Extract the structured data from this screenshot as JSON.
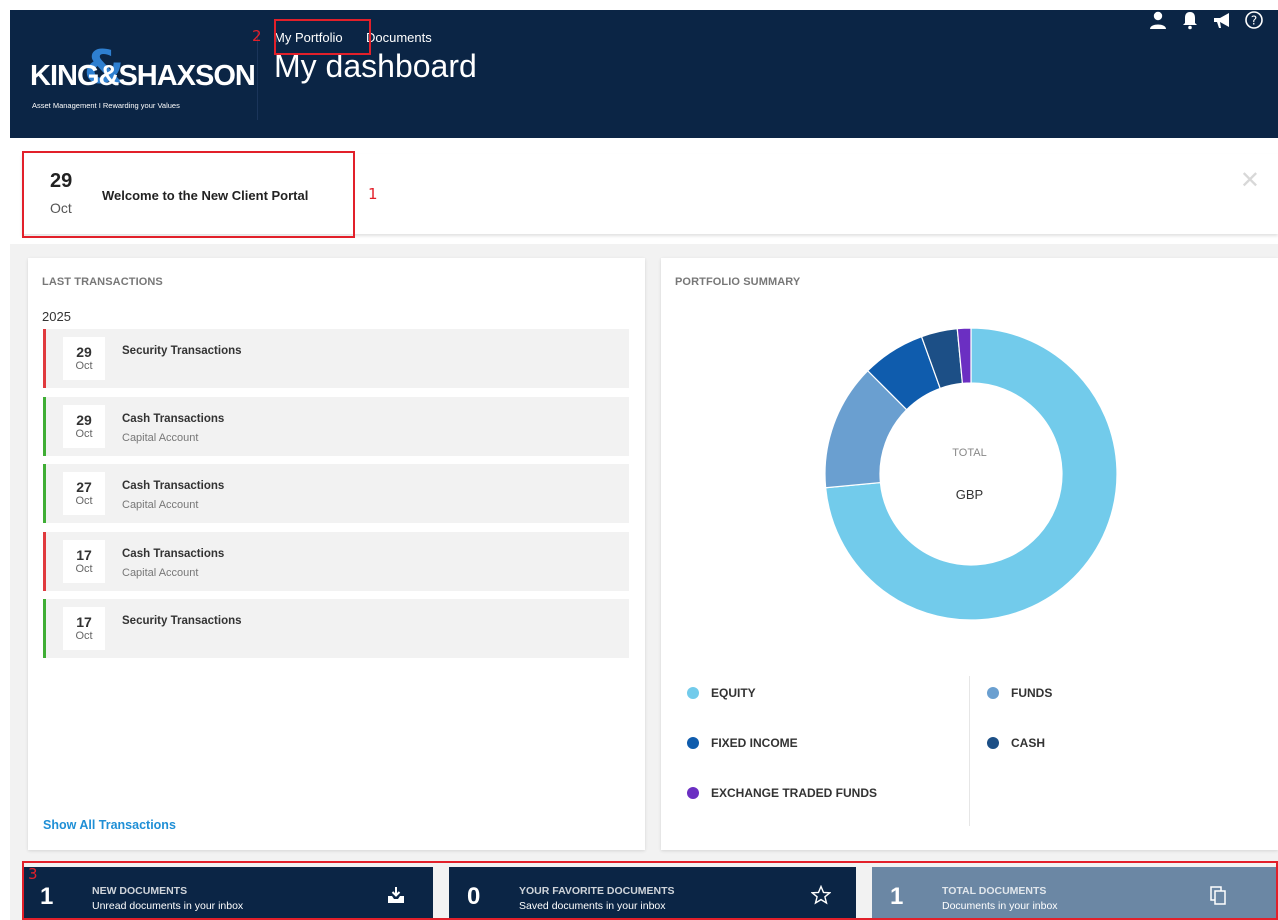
{
  "header": {
    "logo_text": "KING&SHAXSON",
    "logo_tagline": "Asset Management I Rewarding your Values",
    "nav": [
      "My Portfolio",
      "Documents"
    ],
    "title": "My dashboard",
    "icons": [
      "user-icon",
      "bell-icon",
      "megaphone-icon",
      "help-icon"
    ]
  },
  "announcement": {
    "day": "29",
    "month": "Oct",
    "text": "Welcome to the New Client Portal"
  },
  "annotations": [
    "1",
    "2",
    "3"
  ],
  "last_transactions": {
    "title": "LAST TRANSACTIONS",
    "year": "2025",
    "items": [
      {
        "day": "29",
        "month": "Oct",
        "title": "Security Transactions",
        "subtitle": "",
        "status_color": "#e03a3e"
      },
      {
        "day": "29",
        "month": "Oct",
        "title": "Cash Transactions",
        "subtitle": "Capital Account",
        "status_color": "#3fae35"
      },
      {
        "day": "27",
        "month": "Oct",
        "title": "Cash Transactions",
        "subtitle": "Capital Account",
        "status_color": "#3fae35"
      },
      {
        "day": "17",
        "month": "Oct",
        "title": "Cash Transactions",
        "subtitle": "Capital Account",
        "status_color": "#e03a3e"
      },
      {
        "day": "17",
        "month": "Oct",
        "title": "Security Transactions",
        "subtitle": "",
        "status_color": "#3fae35"
      }
    ],
    "show_all": "Show All Transactions"
  },
  "portfolio_summary": {
    "title": "PORTFOLIO SUMMARY",
    "center_label": "TOTAL",
    "currency": "GBP",
    "legend": [
      {
        "label": "EQUITY",
        "color": "#72cbeb"
      },
      {
        "label": "FUNDS",
        "color": "#6a9fd0"
      },
      {
        "label": "FIXED INCOME",
        "color": "#0f5cad"
      },
      {
        "label": "CASH",
        "color": "#1c4f86"
      },
      {
        "label": "EXCHANGE TRADED FUNDS",
        "color": "#6b2fc2"
      }
    ]
  },
  "chart_data": {
    "type": "pie",
    "title": "",
    "categories": [
      "EQUITY",
      "FUNDS",
      "FIXED INCOME",
      "CASH",
      "EXCHANGE TRADED FUNDS"
    ],
    "values": [
      73.5,
      14,
      7,
      4,
      1.5
    ],
    "colors": [
      "#72cbeb",
      "#6a9fd0",
      "#0f5cad",
      "#1c4f86",
      "#6b2fc2"
    ],
    "donut": true,
    "legend_position": "bottom"
  },
  "tiles": [
    {
      "count": "1",
      "title": "NEW DOCUMENTS",
      "subtitle": "Unread documents in your inbox",
      "icon": "inbox-download-icon"
    },
    {
      "count": "0",
      "title": "YOUR FAVORITE DOCUMENTS",
      "subtitle": "Saved documents in your inbox",
      "icon": "star-icon"
    },
    {
      "count": "1",
      "title": "TOTAL DOCUMENTS",
      "subtitle": "Documents in your inbox",
      "icon": "documents-icon"
    }
  ]
}
